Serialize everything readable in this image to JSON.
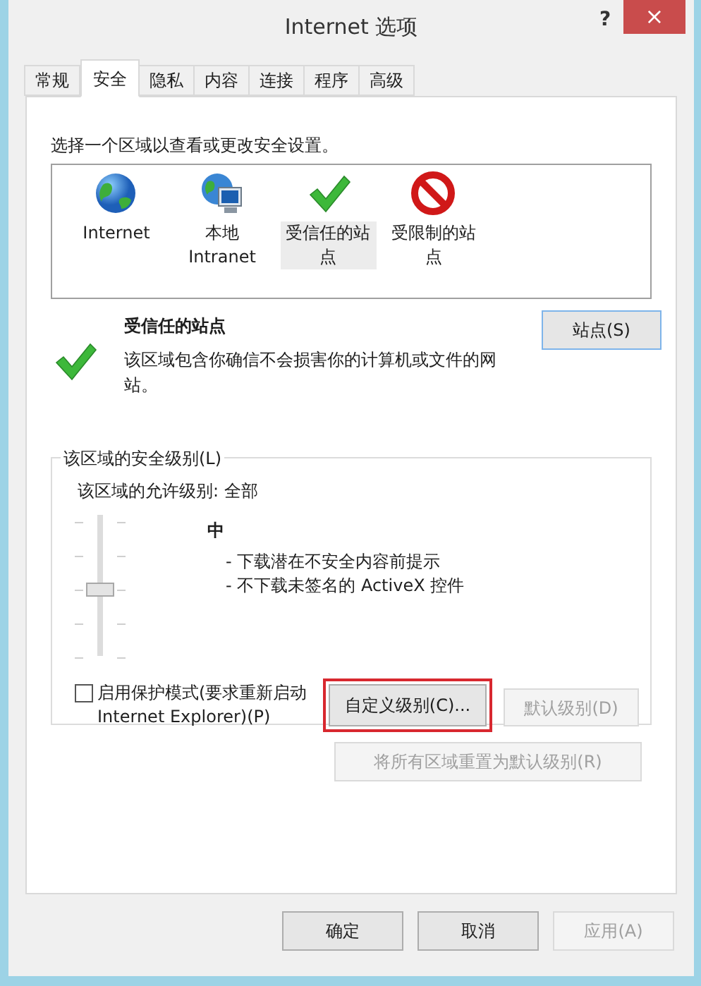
{
  "window": {
    "title": "Internet 选项",
    "help": "?",
    "close": "×"
  },
  "tabs": [
    {
      "label": "常规",
      "selected": false
    },
    {
      "label": "安全",
      "selected": true
    },
    {
      "label": "隐私",
      "selected": false
    },
    {
      "label": "内容",
      "selected": false
    },
    {
      "label": "连接",
      "selected": false
    },
    {
      "label": "程序",
      "selected": false
    },
    {
      "label": "高级",
      "selected": false
    }
  ],
  "zone_prompt": "选择一个区域以查看或更改安全设置。",
  "zones": [
    {
      "kind": "globe",
      "label": "Internet",
      "selected": false
    },
    {
      "kind": "intranet",
      "label": "本地 Intranet",
      "selected": false
    },
    {
      "kind": "trusted",
      "label": "受信任的站点",
      "selected": true
    },
    {
      "kind": "restricted",
      "label": "受限制的站点",
      "selected": false
    }
  ],
  "zone_info": {
    "kind": "trusted",
    "title": "受信任的站点",
    "description": "该区域包含你确信不会损害你的计算机或文件的网站。",
    "sites_button": "站点(S)"
  },
  "security_level": {
    "group_label": "该区域的安全级别(L)",
    "allowed": "该区域的允许级别: 全部",
    "level": 0.5,
    "level_name": "中",
    "bullets": [
      "- 下载潜在不安全内容前提示",
      "- 不下载未签名的 ActiveX 控件"
    ],
    "protected_mode": {
      "label": "启用保护模式(要求重新启动 Internet Explorer)(P)",
      "checked": false
    },
    "custom_button": {
      "label": "自定义级别(C)...",
      "highlighted": true,
      "disabled": false
    },
    "default_button": {
      "label": "默认级别(D)",
      "disabled": true
    }
  },
  "reset_all_button": {
    "label": "将所有区域重置为默认级别(R)",
    "disabled": true
  },
  "footer_buttons": [
    {
      "label": "确定",
      "disabled": false
    },
    {
      "label": "取消",
      "disabled": false
    },
    {
      "label": "应用(A)",
      "disabled": true
    }
  ]
}
